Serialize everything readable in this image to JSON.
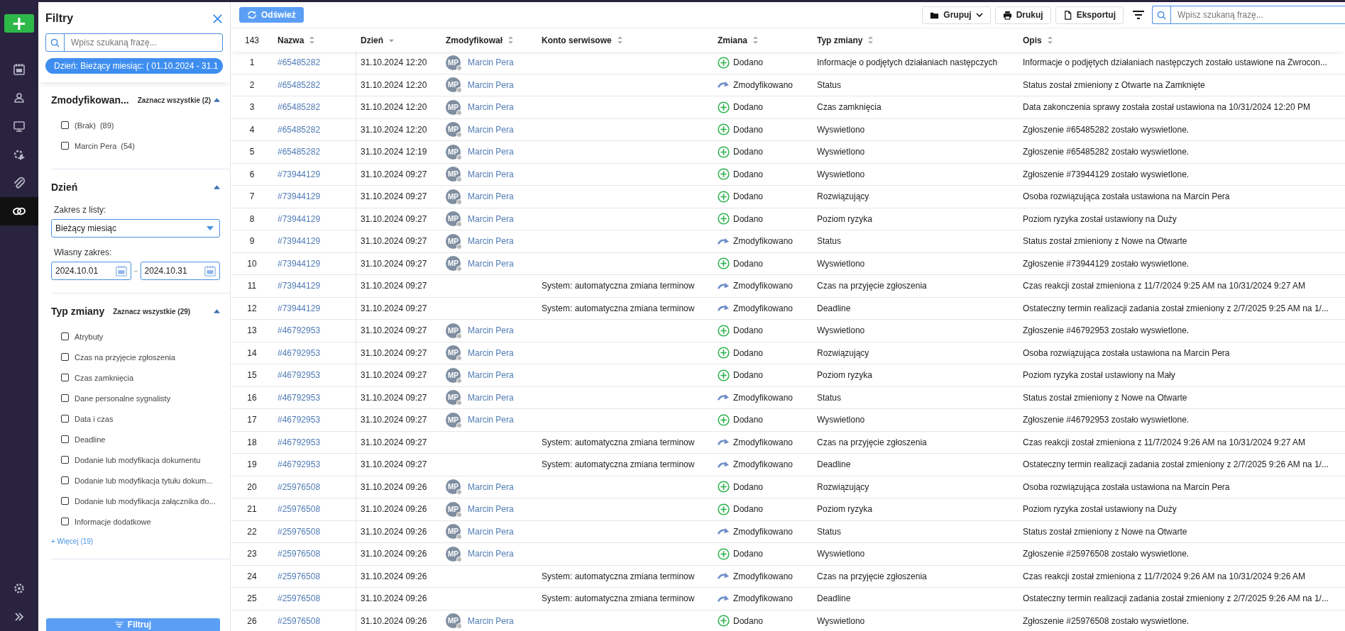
{
  "nav": {
    "add_button": "+",
    "items": [
      {
        "selected": false
      },
      {
        "selected": false
      },
      {
        "selected": false
      },
      {
        "selected": false
      },
      {
        "selected": false
      },
      {
        "selected": true
      }
    ]
  },
  "filters": {
    "title": "Filtry",
    "search": {
      "placeholder": "Wpisz szukaną frazę..."
    },
    "active_chip": "Dzień: Bieżący miesiąc: ( 01.10.2024 - 31.1",
    "sections": [
      {
        "kind": "checklist",
        "title": "Zmodyfikowan...",
        "select_all": "Zaznacz wszystkie (2)",
        "expanded": true,
        "options": [
          {
            "label": "(Brak)",
            "count": "(89)",
            "checked": false
          },
          {
            "label": "Marcin Pera",
            "count": "(54)",
            "checked": false
          }
        ]
      },
      {
        "kind": "date",
        "title": "Dzień",
        "expanded": true,
        "range_label": "Zakres z listy:",
        "range_value": "Bieżący miesiąc",
        "custom_label": "Własny zakres:",
        "from": "2024.10.01",
        "to": "2024.10.31"
      },
      {
        "kind": "checklist",
        "title": "Typ zmiany",
        "select_all": "Zaznacz wszystkie (29)",
        "expanded": true,
        "more": "+ Więcej (19)",
        "options": [
          {
            "label": "Atrybuty",
            "checked": false
          },
          {
            "label": "Czas na przyjęcie zgłoszenia",
            "checked": false
          },
          {
            "label": "Czas zamknięcia",
            "checked": false
          },
          {
            "label": "Dane personalne sygnalisty",
            "checked": false
          },
          {
            "label": "Data i czas",
            "checked": false
          },
          {
            "label": "Deadline",
            "checked": false
          },
          {
            "label": "Dodanie lub modyfikacja dokumentu",
            "checked": false
          },
          {
            "label": "Dodanie lub modyfikacja tytułu dokum...",
            "checked": false
          },
          {
            "label": "Dodanie lub modyfikacja załącznika do...",
            "checked": false
          },
          {
            "label": "Informacje dodatkowe",
            "checked": false
          }
        ]
      }
    ],
    "button": "Filtruj"
  },
  "toolbar": {
    "refresh": "Odśwież",
    "group": "Grupuj",
    "print": "Drukuj",
    "export": "Eksportuj",
    "search": {
      "placeholder": "Wpisz szukaną frazę..."
    }
  },
  "table": {
    "count": "143",
    "columns": [
      {
        "label": "Nazwa",
        "sorted": false
      },
      {
        "label": "Dzień",
        "sorted": true
      },
      {
        "label": "Zmodyfikował",
        "sorted": false
      },
      {
        "label": "Konto serwisowe",
        "sorted": false
      },
      {
        "label": "Zmiana",
        "sorted": false
      },
      {
        "label": "Typ zmiany",
        "sorted": false
      },
      {
        "label": "Opis",
        "sorted": false
      }
    ],
    "rows": [
      {
        "n": "1",
        "name": "#65485282",
        "day": "31.10.2024 12:20",
        "user": {
          "initials": "MP",
          "name": "Marcin Pera"
        },
        "change": {
          "kind": "added",
          "label": "Dodano"
        },
        "type": "Informacje o podjętych działaniach następczych",
        "desc": "Informacje o podjętych działaniach następczych zostało ustawione na Zwrocon..."
      },
      {
        "n": "2",
        "name": "#65485282",
        "day": "31.10.2024 12:20",
        "user": {
          "initials": "MP",
          "name": "Marcin Pera"
        },
        "change": {
          "kind": "modified",
          "label": "Zmodyfikowano"
        },
        "type": "Status",
        "desc": "Status został zmieniony z Otwarte na Zamknięte"
      },
      {
        "n": "3",
        "name": "#65485282",
        "day": "31.10.2024 12:20",
        "user": {
          "initials": "MP",
          "name": "Marcin Pera"
        },
        "change": {
          "kind": "added",
          "label": "Dodano"
        },
        "type": "Czas zamknięcia",
        "desc": "Data zakonczenia sprawy została został ustawiona na 10/31/2024 12:20 PM"
      },
      {
        "n": "4",
        "name": "#65485282",
        "day": "31.10.2024 12:20",
        "user": {
          "initials": "MP",
          "name": "Marcin Pera"
        },
        "change": {
          "kind": "added",
          "label": "Dodano"
        },
        "type": "Wyswietlono",
        "desc": "Zgłoszenie #65485282 zostało wyswietlone."
      },
      {
        "n": "5",
        "name": "#65485282",
        "day": "31.10.2024 12:19",
        "user": {
          "initials": "MP",
          "name": "Marcin Pera"
        },
        "change": {
          "kind": "added",
          "label": "Dodano"
        },
        "type": "Wyswietlono",
        "desc": "Zgłoszenie #65485282 zostało wyswietlone."
      },
      {
        "n": "6",
        "name": "#73944129",
        "day": "31.10.2024 09:27",
        "user": {
          "initials": "MP",
          "name": "Marcin Pera"
        },
        "change": {
          "kind": "added",
          "label": "Dodano"
        },
        "type": "Wyswietlono",
        "desc": "Zgłoszenie #73944129 zostało wyswietlone."
      },
      {
        "n": "7",
        "name": "#73944129",
        "day": "31.10.2024 09:27",
        "user": {
          "initials": "MP",
          "name": "Marcin Pera"
        },
        "change": {
          "kind": "added",
          "label": "Dodano"
        },
        "type": "Rozwiązujący",
        "desc": "Osoba rozwiązująca została ustawiona na Marcin Pera"
      },
      {
        "n": "8",
        "name": "#73944129",
        "day": "31.10.2024 09:27",
        "user": {
          "initials": "MP",
          "name": "Marcin Pera"
        },
        "change": {
          "kind": "added",
          "label": "Dodano"
        },
        "type": "Poziom ryzyka",
        "desc": "Poziom ryzyka został ustawiony na Duży"
      },
      {
        "n": "9",
        "name": "#73944129",
        "day": "31.10.2024 09:27",
        "user": {
          "initials": "MP",
          "name": "Marcin Pera"
        },
        "change": {
          "kind": "modified",
          "label": "Zmodyfikowano"
        },
        "type": "Status",
        "desc": "Status został zmieniony z Nowe na Otwarte"
      },
      {
        "n": "10",
        "name": "#73944129",
        "day": "31.10.2024 09:27",
        "user": {
          "initials": "MP",
          "name": "Marcin Pera"
        },
        "change": {
          "kind": "added",
          "label": "Dodano"
        },
        "type": "Wyswietlono",
        "desc": "Zgłoszenie #73944129 zostało wyswietlone."
      },
      {
        "n": "11",
        "name": "#73944129",
        "day": "31.10.2024 09:27",
        "account": "System: automatyczna zmiana terminow",
        "change": {
          "kind": "modified",
          "label": "Zmodyfikowano"
        },
        "type": "Czas na przyjęcie zgłoszenia",
        "desc": "Czas reakcji został zmieniona z 11/7/2024 9:25 AM na 10/31/2024 9:27 AM"
      },
      {
        "n": "12",
        "name": "#73944129",
        "day": "31.10.2024 09:27",
        "account": "System: automatyczna zmiana terminow",
        "change": {
          "kind": "modified",
          "label": "Zmodyfikowano"
        },
        "type": "Deadline",
        "desc": "Ostateczny termin realizacji zadania został zmieniony z 2/7/2025 9:25 AM na 1/..."
      },
      {
        "n": "13",
        "name": "#46792953",
        "day": "31.10.2024 09:27",
        "user": {
          "initials": "MP",
          "name": "Marcin Pera"
        },
        "change": {
          "kind": "added",
          "label": "Dodano"
        },
        "type": "Wyswietlono",
        "desc": "Zgłoszenie #46792953 zostało wyswietlone."
      },
      {
        "n": "14",
        "name": "#46792953",
        "day": "31.10.2024 09:27",
        "user": {
          "initials": "MP",
          "name": "Marcin Pera"
        },
        "change": {
          "kind": "added",
          "label": "Dodano"
        },
        "type": "Rozwiązujący",
        "desc": "Osoba rozwiązująca została ustawiona na Marcin Pera"
      },
      {
        "n": "15",
        "name": "#46792953",
        "day": "31.10.2024 09:27",
        "user": {
          "initials": "MP",
          "name": "Marcin Pera"
        },
        "change": {
          "kind": "added",
          "label": "Dodano"
        },
        "type": "Poziom ryzyka",
        "desc": "Poziom ryzyka został ustawiony na Mały"
      },
      {
        "n": "16",
        "name": "#46792953",
        "day": "31.10.2024 09:27",
        "user": {
          "initials": "MP",
          "name": "Marcin Pera"
        },
        "change": {
          "kind": "modified",
          "label": "Zmodyfikowano"
        },
        "type": "Status",
        "desc": "Status został zmieniony z Nowe na Otwarte"
      },
      {
        "n": "17",
        "name": "#46792953",
        "day": "31.10.2024 09:27",
        "user": {
          "initials": "MP",
          "name": "Marcin Pera"
        },
        "change": {
          "kind": "added",
          "label": "Dodano"
        },
        "type": "Wyswietlono",
        "desc": "Zgłoszenie #46792953 zostało wyswietlone."
      },
      {
        "n": "18",
        "name": "#46792953",
        "day": "31.10.2024 09:27",
        "account": "System: automatyczna zmiana terminow",
        "change": {
          "kind": "modified",
          "label": "Zmodyfikowano"
        },
        "type": "Czas na przyjęcie zgłoszenia",
        "desc": "Czas reakcji został zmieniona z 11/7/2024 9:26 AM na 10/31/2024 9:27 AM"
      },
      {
        "n": "19",
        "name": "#46792953",
        "day": "31.10.2024 09:27",
        "account": "System: automatyczna zmiana terminow",
        "change": {
          "kind": "modified",
          "label": "Zmodyfikowano"
        },
        "type": "Deadline",
        "desc": "Ostateczny termin realizacji zadania został zmieniony z 2/7/2025 9:26 AM na 1/..."
      },
      {
        "n": "20",
        "name": "#25976508",
        "day": "31.10.2024 09:26",
        "user": {
          "initials": "MP",
          "name": "Marcin Pera"
        },
        "change": {
          "kind": "added",
          "label": "Dodano"
        },
        "type": "Rozwiązujący",
        "desc": "Osoba rozwiązująca została ustawiona na Marcin Pera"
      },
      {
        "n": "21",
        "name": "#25976508",
        "day": "31.10.2024 09:26",
        "user": {
          "initials": "MP",
          "name": "Marcin Pera"
        },
        "change": {
          "kind": "added",
          "label": "Dodano"
        },
        "type": "Poziom ryzyka",
        "desc": "Poziom ryzyka został ustawiony na Duży"
      },
      {
        "n": "22",
        "name": "#25976508",
        "day": "31.10.2024 09:26",
        "user": {
          "initials": "MP",
          "name": "Marcin Pera"
        },
        "change": {
          "kind": "modified",
          "label": "Zmodyfikowano"
        },
        "type": "Status",
        "desc": "Status został zmieniony z Nowe na Otwarte"
      },
      {
        "n": "23",
        "name": "#25976508",
        "day": "31.10.2024 09:26",
        "user": {
          "initials": "MP",
          "name": "Marcin Pera"
        },
        "change": {
          "kind": "added",
          "label": "Dodano"
        },
        "type": "Wyswietlono",
        "desc": "Zgłoszenie #25976508 zostało wyswietlone."
      },
      {
        "n": "24",
        "name": "#25976508",
        "day": "31.10.2024 09:26",
        "account": "System: automatyczna zmiana terminow",
        "change": {
          "kind": "modified",
          "label": "Zmodyfikowano"
        },
        "type": "Czas na przyjęcie zgłoszenia",
        "desc": "Czas reakcji został zmieniona z 11/7/2024 9:26 AM na 10/31/2024 9:26 AM"
      },
      {
        "n": "25",
        "name": "#25976508",
        "day": "31.10.2024 09:26",
        "account": "System: automatyczna zmiana terminow",
        "change": {
          "kind": "modified",
          "label": "Zmodyfikowano"
        },
        "type": "Deadline",
        "desc": "Ostateczny termin realizacji zadania został zmieniony z 2/7/2025 9:26 AM na 1/..."
      },
      {
        "n": "26",
        "name": "#25976508",
        "day": "31.10.2024 09:26",
        "user": {
          "initials": "MP",
          "name": "Marcin Pera"
        },
        "change": {
          "kind": "added",
          "label": "Dodano"
        },
        "type": "Wyswietlono",
        "desc": "Zgłoszenie #25976508 zostało wyswietlone."
      }
    ]
  }
}
